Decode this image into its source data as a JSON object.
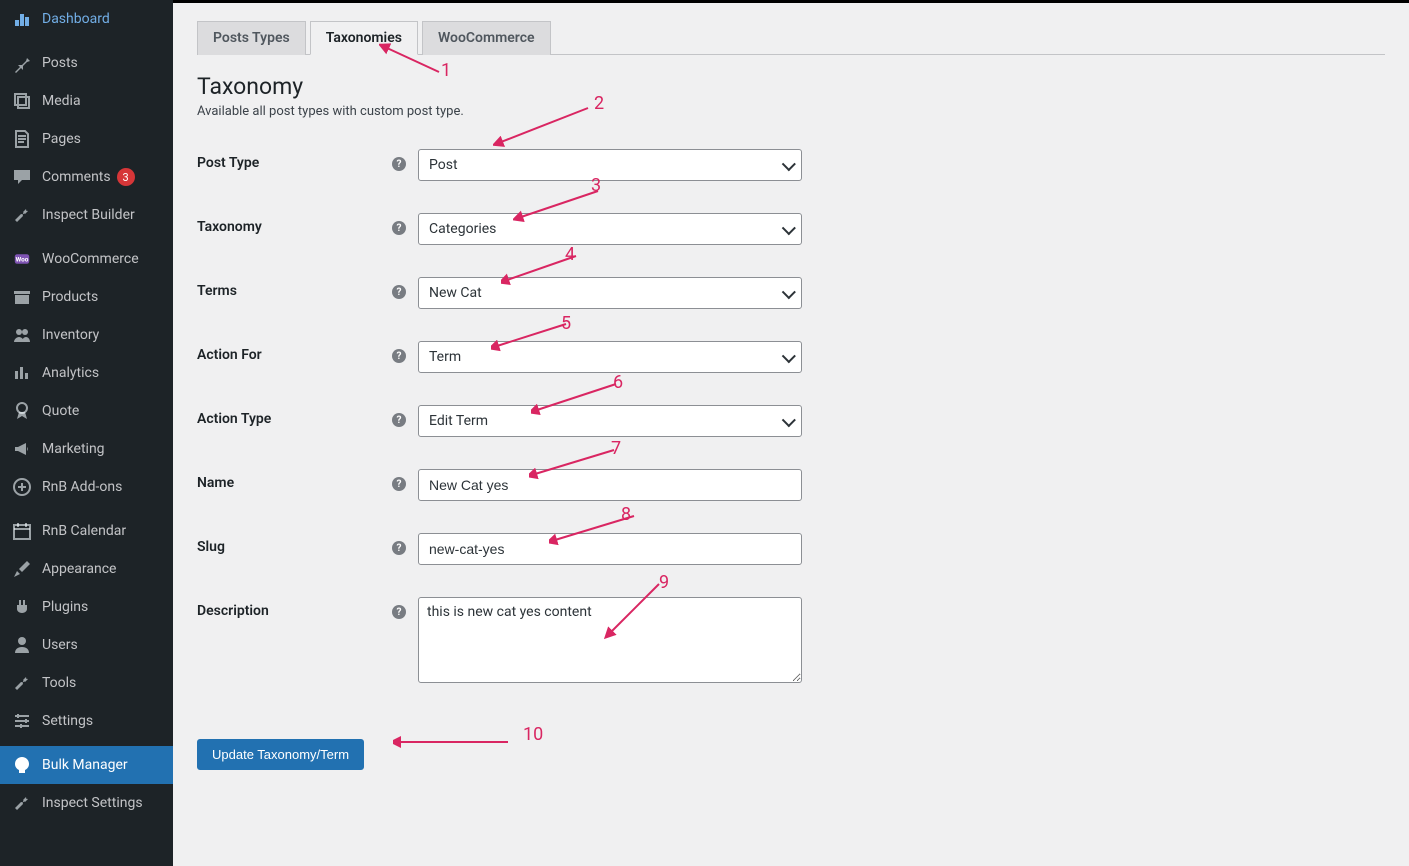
{
  "sidebar": {
    "items": [
      {
        "label": "Dashboard",
        "icon": "dashboard"
      },
      {
        "label": "Posts",
        "icon": "pin",
        "sep": true
      },
      {
        "label": "Media",
        "icon": "media"
      },
      {
        "label": "Pages",
        "icon": "page"
      },
      {
        "label": "Comments",
        "icon": "comment",
        "badge": "3"
      },
      {
        "label": "Inspect Builder",
        "icon": "wrench"
      },
      {
        "label": "WooCommerce",
        "icon": "woo",
        "sep": true
      },
      {
        "label": "Products",
        "icon": "product"
      },
      {
        "label": "Inventory",
        "icon": "people"
      },
      {
        "label": "Analytics",
        "icon": "stats"
      },
      {
        "label": "Quote",
        "icon": "award"
      },
      {
        "label": "Marketing",
        "icon": "megaphone"
      },
      {
        "label": "RnB Add-ons",
        "icon": "plus-circle"
      },
      {
        "label": "RnB Calendar",
        "icon": "calendar",
        "sep": true
      },
      {
        "label": "Appearance",
        "icon": "brush"
      },
      {
        "label": "Plugins",
        "icon": "plugin"
      },
      {
        "label": "Users",
        "icon": "user"
      },
      {
        "label": "Tools",
        "icon": "wrench"
      },
      {
        "label": "Settings",
        "icon": "settings"
      },
      {
        "label": "Bulk Manager",
        "icon": "filter",
        "active": true,
        "sep": true
      },
      {
        "label": "Inspect Settings",
        "icon": "wrench"
      }
    ]
  },
  "tabs": [
    {
      "label": "Posts Types",
      "active": false
    },
    {
      "label": "Taxonomies",
      "active": true
    },
    {
      "label": "WooCommerce",
      "active": false
    }
  ],
  "section": {
    "title": "Taxonomy",
    "desc": "Available all post types with custom post type."
  },
  "form": {
    "post_type": {
      "label": "Post Type",
      "value": "Post"
    },
    "taxonomy": {
      "label": "Taxonomy",
      "value": "Categories"
    },
    "terms": {
      "label": "Terms",
      "value": "New Cat"
    },
    "action_for": {
      "label": "Action For",
      "value": "Term"
    },
    "action_type": {
      "label": "Action Type",
      "value": "Edit Term"
    },
    "name": {
      "label": "Name",
      "value": "New Cat yes"
    },
    "slug": {
      "label": "Slug",
      "value": "new-cat-yes"
    },
    "description": {
      "label": "Description",
      "value": "this is new cat yes content"
    },
    "submit": "Update Taxonomy/Term"
  },
  "annotations": [
    "1",
    "2",
    "3",
    "4",
    "5",
    "6",
    "7",
    "8",
    "9",
    "10"
  ]
}
